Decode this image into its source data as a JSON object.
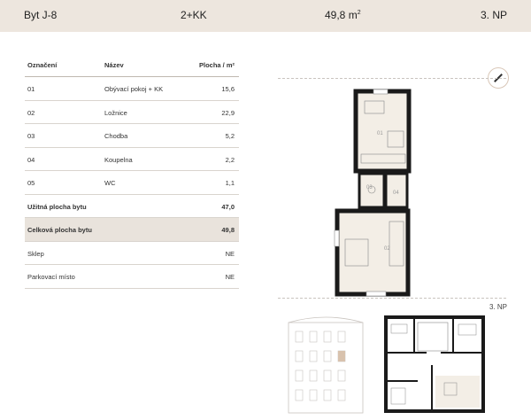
{
  "header": {
    "unit": "Byt J-8",
    "layout": "2+KK",
    "area_value": "49,8 m",
    "area_sup": "2",
    "floor": "3. NP"
  },
  "table": {
    "col_code": "Označení",
    "col_name": "Název",
    "col_area": "Plocha / m²",
    "rooms": [
      {
        "code": "01",
        "name": "Obývací pokoj + KK",
        "area": "15,6"
      },
      {
        "code": "02",
        "name": "Ložnice",
        "area": "22,9"
      },
      {
        "code": "03",
        "name": "Chodba",
        "area": "5,2"
      },
      {
        "code": "04",
        "name": "Koupelna",
        "area": "2,2"
      },
      {
        "code": "05",
        "name": "WC",
        "area": "1,1"
      }
    ],
    "usable_label": "Užitná plocha bytu",
    "usable_value": "47,0",
    "total_label": "Celková plocha bytu",
    "total_value": "49,8",
    "cellar_label": "Sklep",
    "cellar_value": "NE",
    "parking_label": "Parkovací místo",
    "parking_value": "NE"
  },
  "plan_labels": {
    "r01": "01",
    "r02": "02",
    "r03": "03",
    "r04": "04",
    "floor_plan_label": "3. NP"
  },
  "colors": {
    "header_bg": "#ede6de",
    "highlight_row": "#e9e3dc",
    "room_fill": "#f3eee6",
    "wall": "#1a1a1a"
  }
}
